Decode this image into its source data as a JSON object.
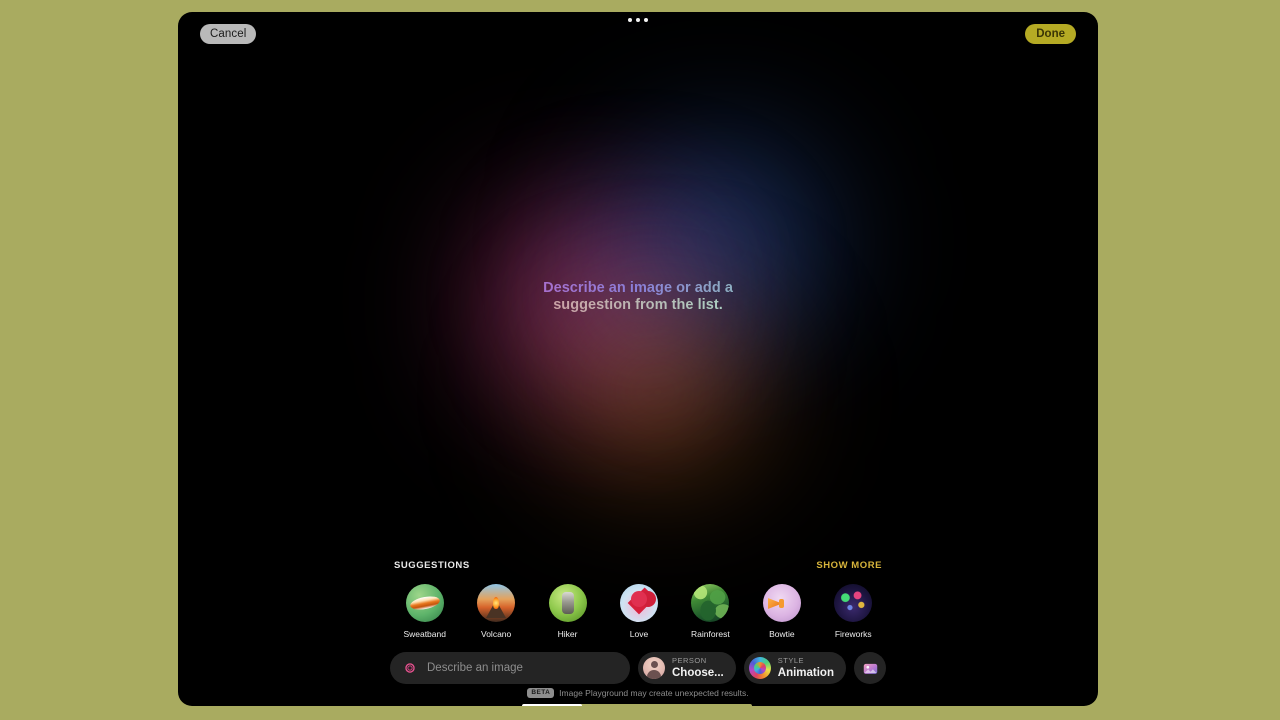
{
  "window": {
    "topbar": {
      "cancel_label": "Cancel",
      "done_label": "Done",
      "grabber_icon": "more-dots-icon"
    },
    "canvas": {
      "prompt_line_1": "Describe an image or add a",
      "prompt_line_2": "suggestion from the list."
    },
    "suggestions": {
      "section_title": "SUGGESTIONS",
      "show_more_label": "SHOW MORE",
      "items": [
        {
          "label": "Sweatband",
          "thumb": "sweatband-thumb"
        },
        {
          "label": "Volcano",
          "thumb": "volcano-thumb"
        },
        {
          "label": "Hiker",
          "thumb": "hiker-thumb"
        },
        {
          "label": "Love",
          "thumb": "love-thumb"
        },
        {
          "label": "Rainforest",
          "thumb": "rainforest-thumb"
        },
        {
          "label": "Bowtie",
          "thumb": "bowtie-thumb"
        },
        {
          "label": "Fireworks",
          "thumb": "fireworks-thumb"
        }
      ]
    },
    "composer": {
      "field_icon": "image-playground-icon",
      "field_value": "",
      "field_placeholder": "Describe an image",
      "person_kicker": "PERSON",
      "person_value": "Choose...",
      "person_icon": "person-avatar-icon",
      "style_kicker": "STYLE",
      "style_value": "Animation",
      "style_icon": "color-wheel-icon",
      "photo_button_icon": "photo-picker-icon"
    },
    "disclaimer": {
      "badge": "BETA",
      "text": "Image Playground may create unexpected results."
    }
  },
  "colors": {
    "desktop_background": "#a9ab60",
    "window_background": "#000000",
    "done_button": "#b5aa24",
    "cancel_button": "#b9b9b9",
    "show_more_accent": "#d7b43b",
    "control_surface": "#242424"
  }
}
